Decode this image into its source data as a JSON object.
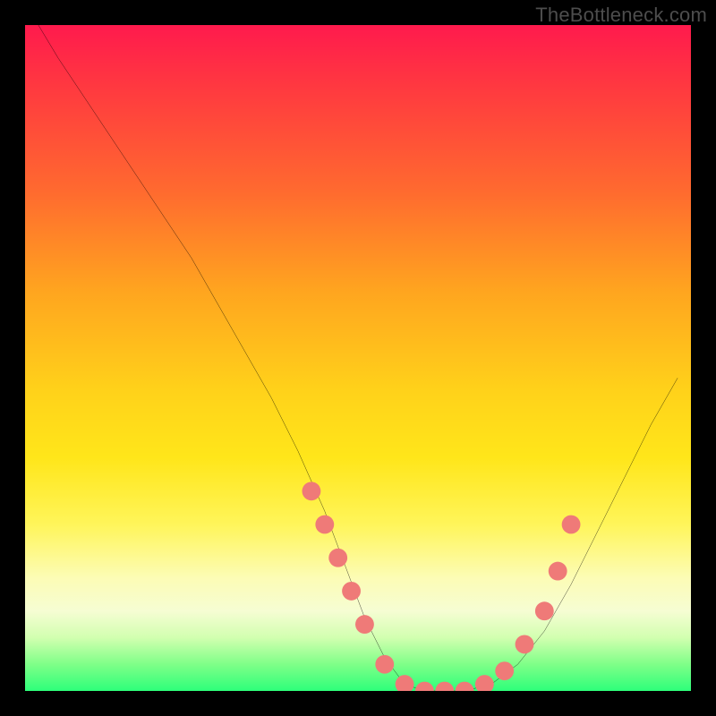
{
  "attribution": "TheBottleneck.com",
  "colors": {
    "frame": "#000000",
    "curve": "#000000",
    "dot_fill": "#ef7a78",
    "dot_stroke": "#ef7a78",
    "gradient_stops": [
      "#ff1a4d",
      "#ff3b3f",
      "#ff6a2f",
      "#ffa51f",
      "#ffd21a",
      "#ffe61a",
      "#fff55a",
      "#fcfcb5",
      "#f6fdd3",
      "#d2ffb0",
      "#7fff88",
      "#2dff7a"
    ]
  },
  "chart_data": {
    "type": "line",
    "title": "",
    "xlabel": "",
    "ylabel": "",
    "xlim": [
      0,
      100
    ],
    "ylim": [
      0,
      100
    ],
    "series": [
      {
        "name": "bottleneck-curve",
        "x": [
          2,
          5,
          9,
          13,
          17,
          21,
          25,
          29,
          33,
          37,
          41,
          45,
          48,
          51,
          54,
          57,
          60,
          63,
          66,
          70,
          74,
          78,
          82,
          86,
          90,
          94,
          98
        ],
        "y": [
          100,
          95,
          89,
          83,
          77,
          71,
          65,
          58,
          51,
          44,
          36,
          27,
          19,
          11,
          5,
          1,
          0,
          0,
          0,
          1,
          4,
          9,
          16,
          24,
          32,
          40,
          47
        ]
      }
    ],
    "dots": {
      "name": "highlight-dots",
      "x": [
        43,
        45,
        47,
        49,
        51,
        54,
        57,
        60,
        63,
        66,
        69,
        72,
        75,
        78,
        80,
        82
      ],
      "y": [
        30,
        25,
        20,
        15,
        10,
        4,
        1,
        0,
        0,
        0,
        1,
        3,
        7,
        12,
        18,
        25
      ]
    }
  }
}
